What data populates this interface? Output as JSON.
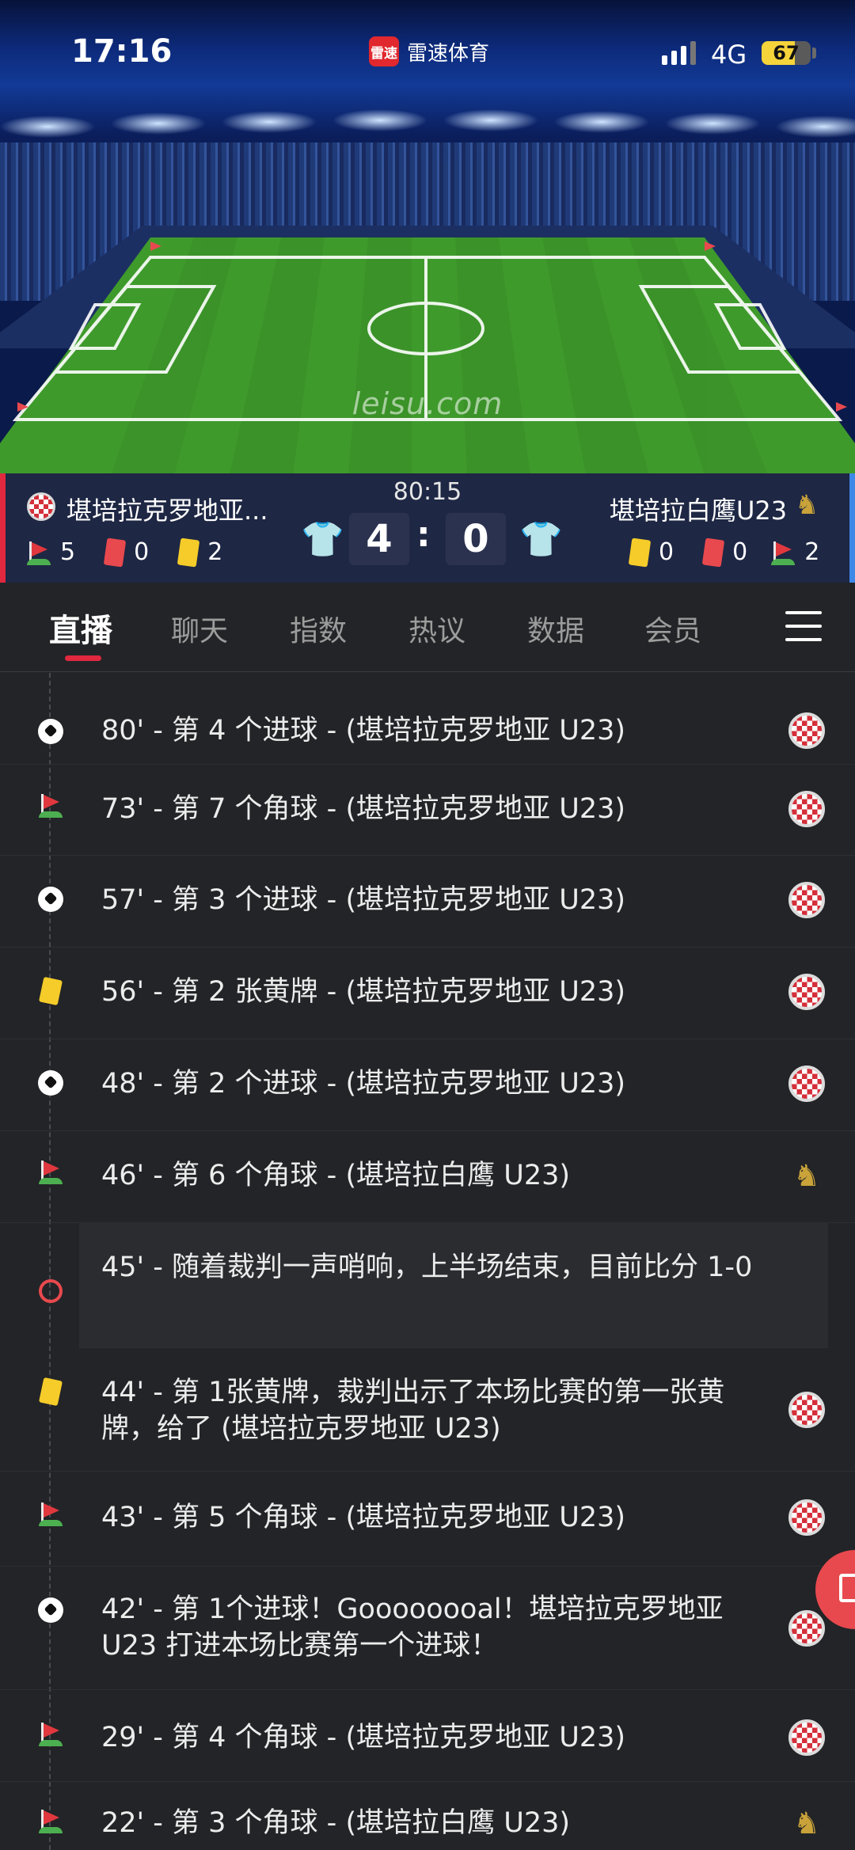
{
  "status_bar": {
    "time": "17:16",
    "app_logo": "雷速",
    "app_name": "雷速体育",
    "network": "4G",
    "battery": "67",
    "battery_level": 0.67
  },
  "hero": {
    "watermark": "leisu.com"
  },
  "match": {
    "clock": "80:15",
    "home": {
      "name": "堪培拉克罗地亚...",
      "corners": "5",
      "red_cards": "0",
      "yellow_cards": "2",
      "score": "4",
      "shirt_color": "#2f7de0"
    },
    "away": {
      "name": "堪培拉白鹰U23",
      "corners": "2",
      "red_cards": "0",
      "yellow_cards": "0",
      "score": "0",
      "shirt_color": "#e0283e"
    },
    "separator": ":"
  },
  "tabs": {
    "items": [
      {
        "label": "直播",
        "active": true
      },
      {
        "label": "聊天"
      },
      {
        "label": "指数"
      },
      {
        "label": "热议"
      },
      {
        "label": "数据"
      },
      {
        "label": "会员"
      }
    ],
    "menu_icon": "hamburger-menu-icon"
  },
  "events": [
    {
      "icon": "goal-ball-icon",
      "text": "80' - 第 4 个进球 - (堪培拉克罗地亚 U23)",
      "team": "home"
    },
    {
      "icon": "corner-flag-icon",
      "text": "73' - 第 7 个角球 - (堪培拉克罗地亚 U23)",
      "team": "home"
    },
    {
      "icon": "goal-ball-icon",
      "text": "57' - 第 3 个进球 - (堪培拉克罗地亚 U23)",
      "team": "home"
    },
    {
      "icon": "yellow-card-icon",
      "text": "56' - 第 2 张黄牌 - (堪培拉克罗地亚 U23)",
      "team": "home"
    },
    {
      "icon": "goal-ball-icon",
      "text": "48' - 第 2 个进球 - (堪培拉克罗地亚 U23)",
      "team": "home"
    },
    {
      "icon": "corner-flag-icon",
      "text": "46' - 第 6 个角球 - (堪培拉白鹰 U23)",
      "team": "away"
    },
    {
      "icon": "whistle-icon",
      "text": "45' - 随着裁判一声哨响，上半场结束，目前比分 1-0",
      "team": "none"
    },
    {
      "icon": "yellow-card-icon",
      "text": "44' - 第 1张黄牌，裁判出示了本场比赛的第一张黄牌，给了 (堪培拉克罗地亚 U23)",
      "team": "home"
    },
    {
      "icon": "corner-flag-icon",
      "text": "43' - 第 5 个角球 - (堪培拉克罗地亚 U23)",
      "team": "home"
    },
    {
      "icon": "goal-ball-icon",
      "text": "42' - 第 1个进球！Goooooooal！堪培拉克罗地亚 U23 打进本场比赛第一个进球！",
      "team": "home"
    },
    {
      "icon": "corner-flag-icon",
      "text": "29' - 第 4 个角球 - (堪培拉克罗地亚 U23)",
      "team": "home"
    },
    {
      "icon": "corner-flag-icon",
      "text": "22' - 第 3 个角球 - (堪培拉白鹰 U23)",
      "team": "away"
    }
  ],
  "fab": {
    "icon": "edit-icon"
  }
}
